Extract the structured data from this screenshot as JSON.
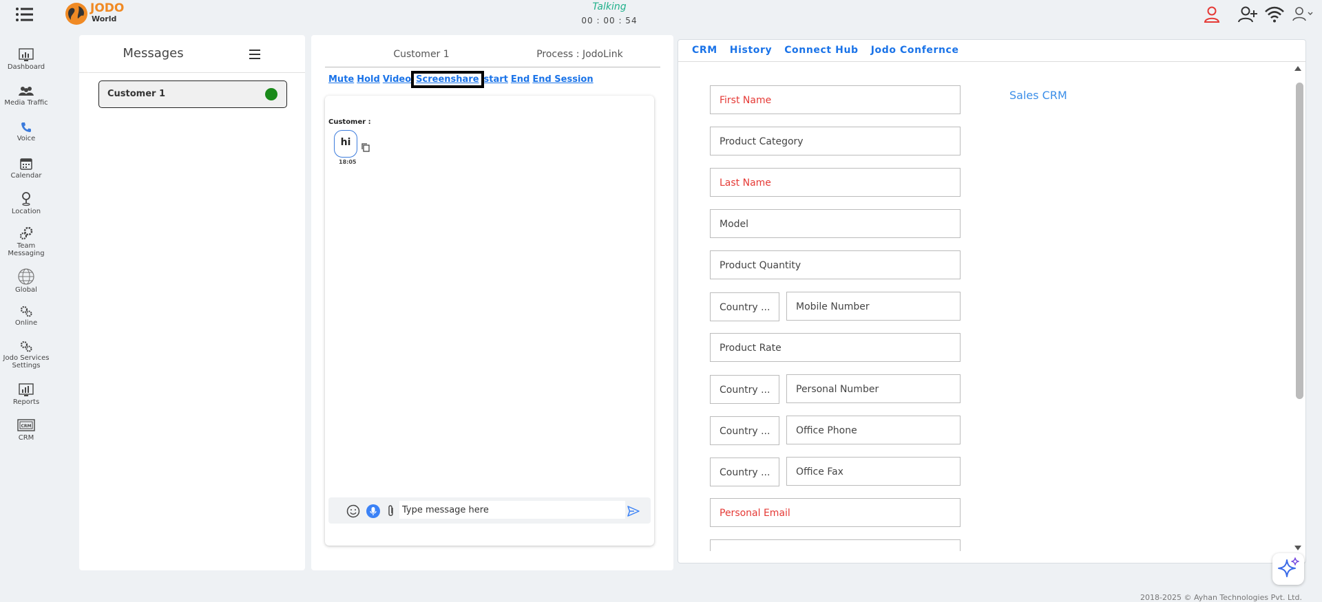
{
  "app": {
    "logo_line1": "JODO",
    "logo_line2": "World"
  },
  "call": {
    "status": "Talking",
    "timer": "00 : 00 : 54"
  },
  "nav": [
    {
      "label": "Dashboard"
    },
    {
      "label": "Media Traffic"
    },
    {
      "label": "Voice"
    },
    {
      "label": "Calendar"
    },
    {
      "label": "Location"
    },
    {
      "label": "Team Messaging"
    },
    {
      "label": "Global"
    },
    {
      "label": "Online"
    },
    {
      "label": "Jodo Services Settings"
    },
    {
      "label": "Reports"
    },
    {
      "label": "CRM"
    }
  ],
  "messages": {
    "title": "Messages",
    "customer": "Customer 1"
  },
  "chat": {
    "customer": "Customer 1",
    "process": "Process : JodoLink",
    "actions": [
      "Mute",
      "Hold",
      "Video",
      "Screenshare",
      "start",
      "End",
      "End Session"
    ],
    "sender": "Customer :",
    "message": "hi",
    "time": "18:05",
    "placeholder": "Type message here"
  },
  "crm": {
    "tabs": [
      "CRM",
      "History",
      "Connect Hub",
      "Jodo Confernce"
    ],
    "heading": "Sales CRM",
    "fields": {
      "first_name": "First Name",
      "product_category": "Product Category",
      "last_name": "Last Name",
      "model": "Model",
      "product_quantity": "Product Quantity",
      "country1": "Country ...",
      "mobile": "Mobile Number",
      "product_rate": "Product Rate",
      "country2": "Country ...",
      "personal_number": "Personal Number",
      "country3": "Country ...",
      "office_phone": "Office Phone",
      "country4": "Country ...",
      "office_fax": "Office Fax",
      "personal_email": "Personal Email"
    }
  },
  "footer": "2018-2025 © Ayhan Technologies Pvt. Ltd.",
  "colors": {
    "accent": "#1a73e8",
    "required": "#e53935",
    "online": "#1a8a1a",
    "talking": "#1fb08a",
    "logo": "#f08a24"
  }
}
